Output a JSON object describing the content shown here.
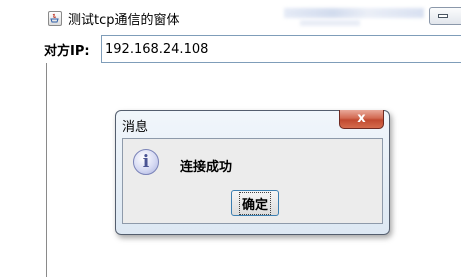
{
  "window": {
    "title": "测试tcp通信的窗体",
    "minimize_icon": "minimize-icon",
    "app_icon": "java-app-icon"
  },
  "ip_row": {
    "label": "对方IP:",
    "value": "192.168.24.108"
  },
  "dialog": {
    "title": "消息",
    "close_label": "x",
    "icon": "info-icon",
    "icon_glyph": "i",
    "message": "连接成功",
    "ok_label": "确定"
  },
  "colors": {
    "dialog_close": "#c14a30",
    "input_border": "#7f9db9",
    "info_icon": "#4a5494"
  }
}
